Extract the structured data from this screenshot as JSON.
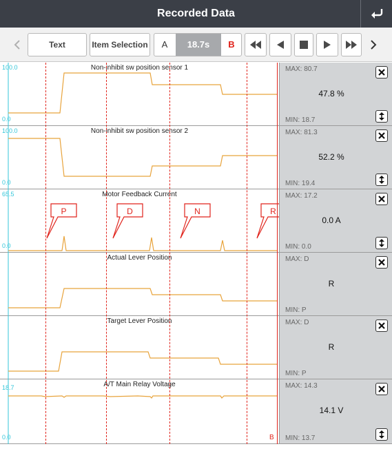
{
  "title": "Recorded Data",
  "icons": {
    "back": "return-icon",
    "prev_page": "chevron-left-icon",
    "next_page": "chevron-right-icon",
    "fast_rewind": "fast-rewind-icon",
    "step_back": "step-back-icon",
    "stop": "stop-icon",
    "play": "play-icon",
    "fast_forward": "fast-forward-icon",
    "close": "close-icon",
    "resize": "resize-vertical-icon"
  },
  "colors": {
    "accent_red": "#e0221a",
    "trace": "#e8a33b",
    "scale_text": "#33c6d9",
    "header": "#3b3f47"
  },
  "toolbar": {
    "text_button": "Text",
    "item_selection_button": "Item Selection",
    "marker_a": "A",
    "current_time": "18.7s",
    "marker_b": "B"
  },
  "marker_labels": [
    "P",
    "D",
    "N",
    "R"
  ],
  "end_marker": "B",
  "panels": [
    {
      "name": "Non-inhibit sw position sensor 1",
      "scale_max": "100.0",
      "scale_min": "0.0",
      "max": "MAX: 80.7",
      "min": "MIN: 18.7",
      "value": "47.8 %"
    },
    {
      "name": "Non-inhibit sw position sensor 2",
      "scale_max": "100.0",
      "scale_min": "0.0",
      "max": "MAX: 81.3",
      "min": "MIN: 19.4",
      "value": "52.2 %"
    },
    {
      "name": "Motor Feedback Current",
      "scale_max": "65.5",
      "scale_min": "0.0",
      "max": "MAX: 17.2",
      "min": "MIN: 0.0",
      "value": "0.0 A"
    },
    {
      "name": "Actual Lever Position",
      "scale_max": "",
      "scale_min": "",
      "max": "MAX: D",
      "min": "MIN: P",
      "value": "R"
    },
    {
      "name": "Target Lever Position",
      "scale_max": "",
      "scale_min": "",
      "max": "MAX: D",
      "min": "MIN: P",
      "value": "R"
    },
    {
      "name": "A/T Main Relay Voltage",
      "scale_max": "18.7",
      "scale_min": "0.0",
      "max": "MAX: 14.3",
      "min": "MIN: 13.7",
      "value": "14.1 V"
    }
  ]
}
